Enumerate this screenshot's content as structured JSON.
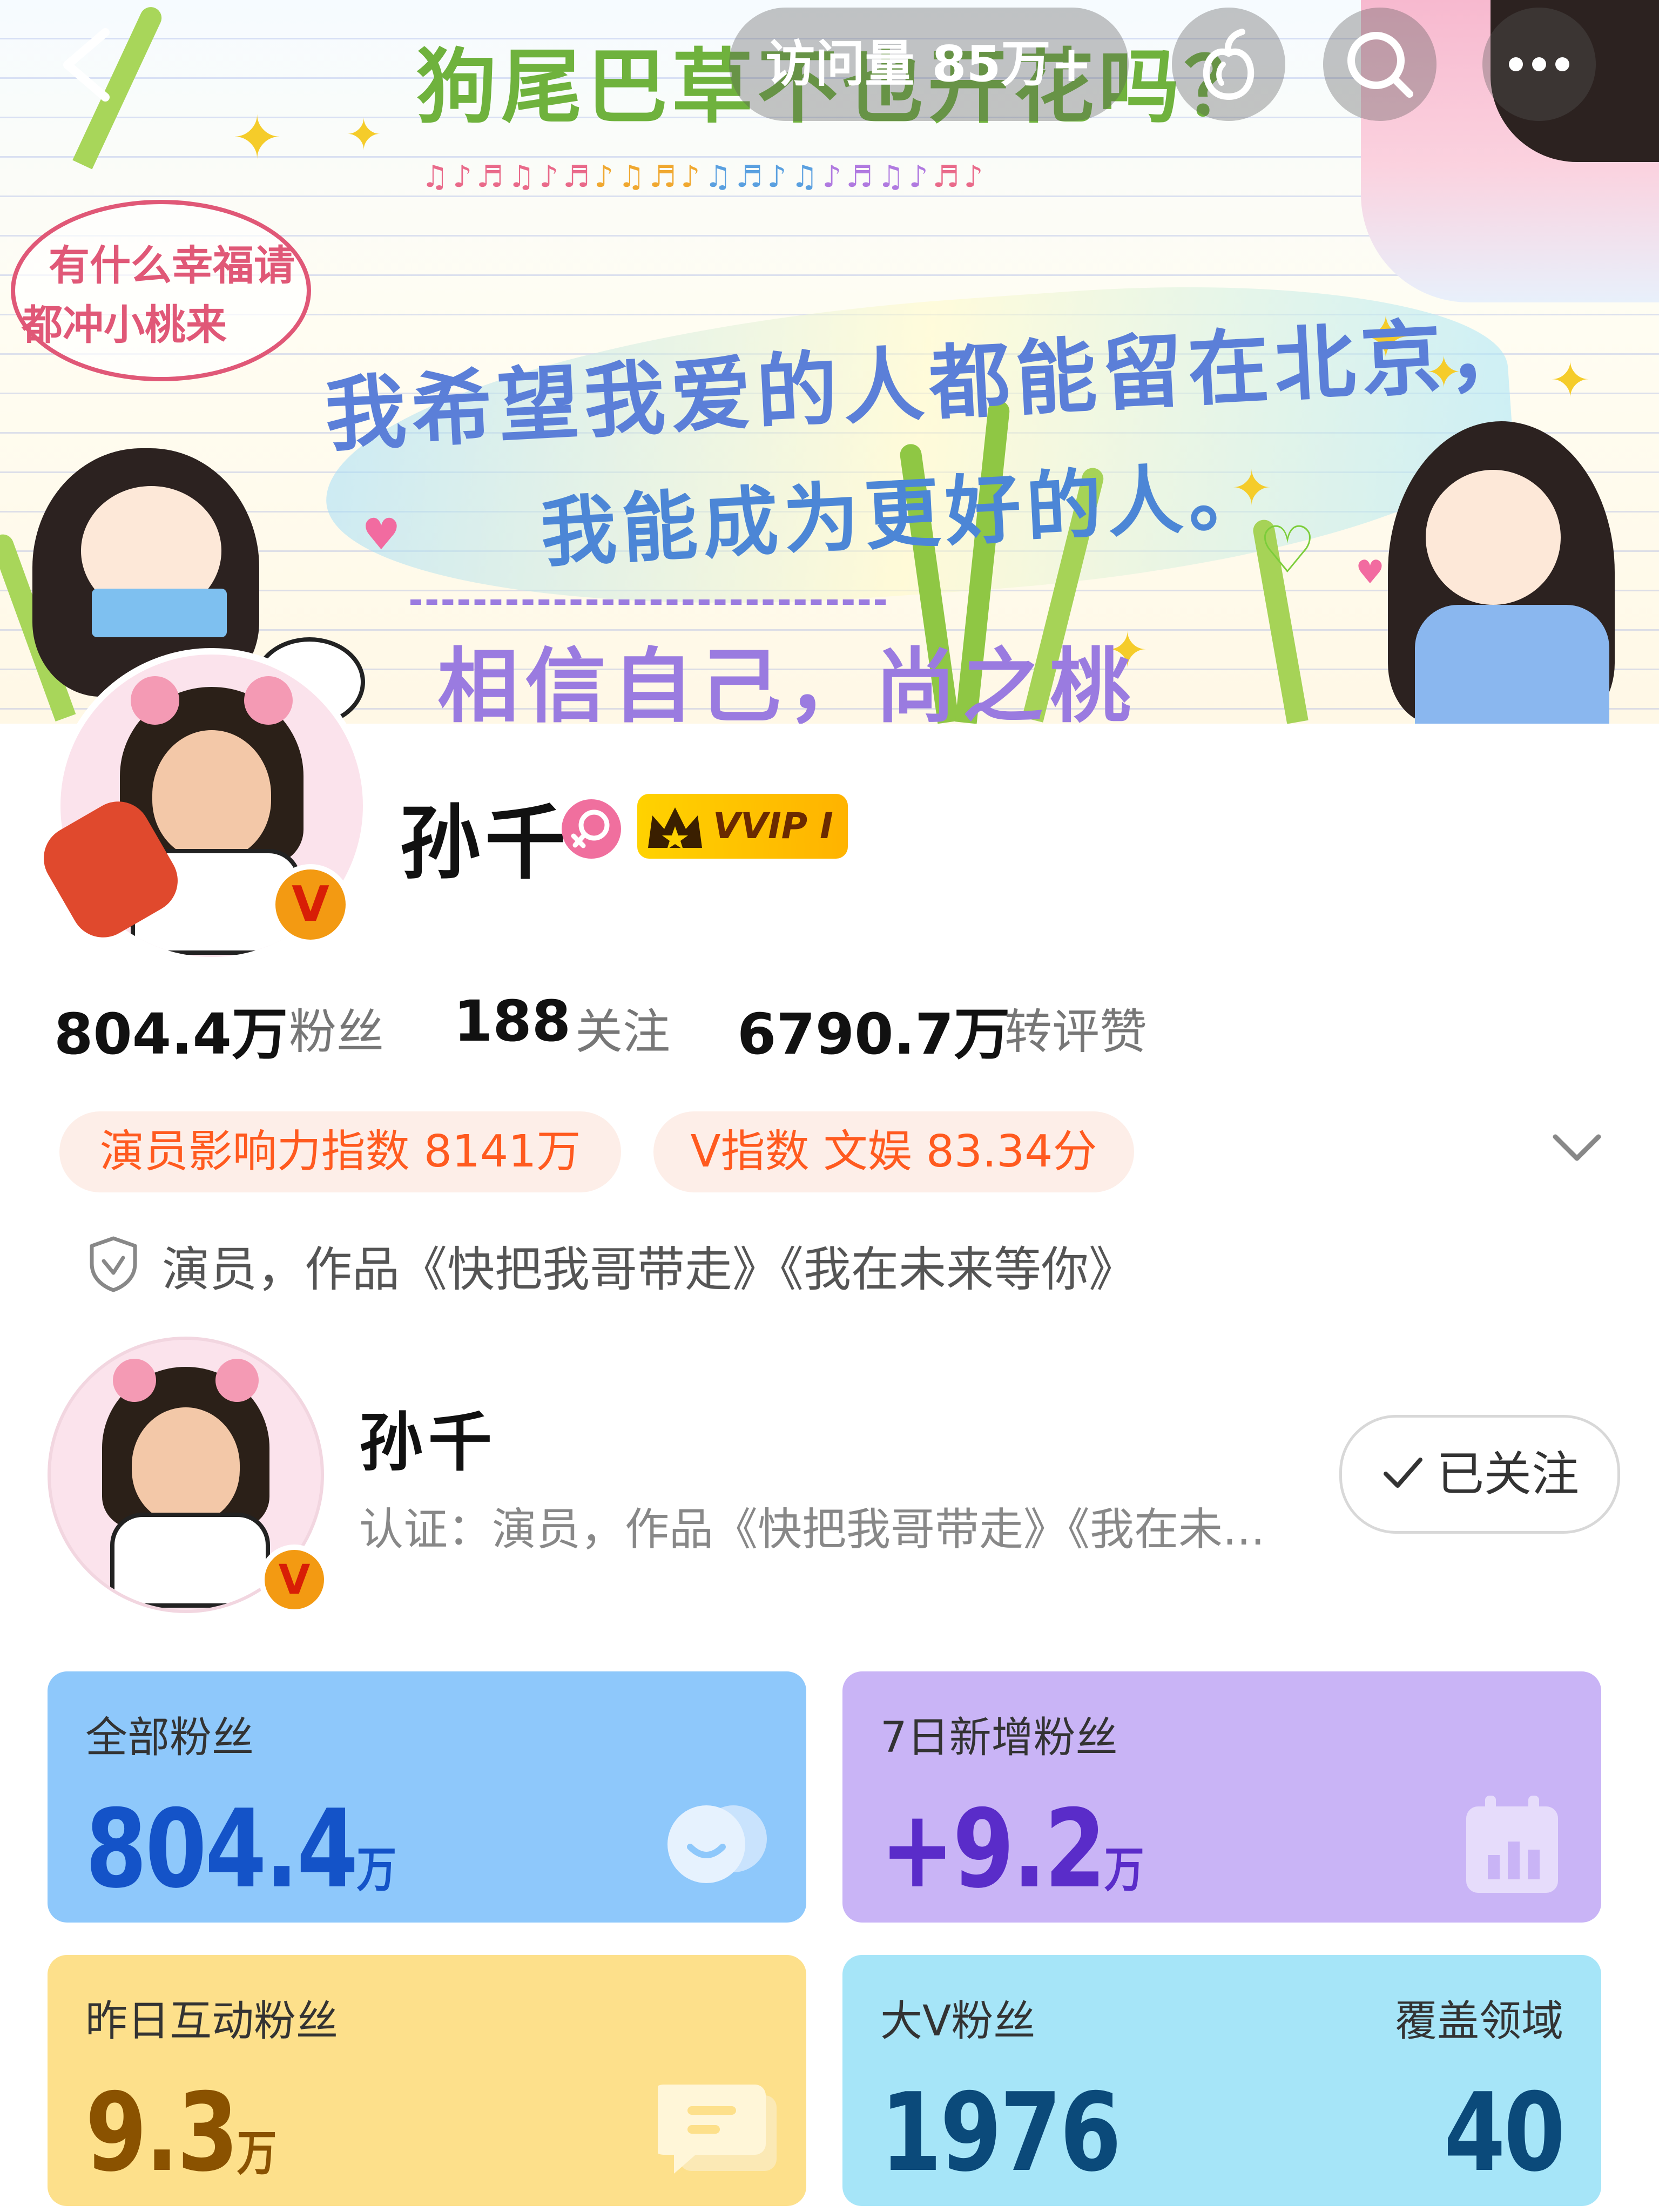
{
  "topbar": {
    "visits_label": "访问量 85万+",
    "back_icon": "chevron-left-icon",
    "peach_icon": "peach-icon",
    "search_icon": "search-icon",
    "more_icon": "more-icon"
  },
  "banner": {
    "title": "狗尾巴草不也开花吗？",
    "bubble_line1": "有什么幸福请",
    "bubble_line2": "都冲小桃来",
    "line1": "我希望我爱的人都能留在北京，",
    "line2": "我能成为更好的人。",
    "line3": "相信自己，尚之桃"
  },
  "profile": {
    "name": "孙千",
    "vip_label": "VVIP I",
    "gender_icon": "female-icon",
    "stats": [
      {
        "value": "804.4万",
        "label": "粉丝"
      },
      {
        "value": "188",
        "label": "关注"
      },
      {
        "value": "6790.7万",
        "label": "转评赞"
      }
    ],
    "chips": [
      "演员影响力指数 8141万",
      "V指数 文娱 83.34分"
    ],
    "verification": "演员，作品《快把我哥带走》《我在未来等你》"
  },
  "follow_card": {
    "name": "孙千",
    "cert": "认证：演员，作品《快把我哥带走》《我在未...",
    "follow_label": "已关注"
  },
  "tiles": {
    "all_fans": {
      "title": "全部粉丝",
      "value": "804.4",
      "unit": "万"
    },
    "new_fans": {
      "title": "7日新增粉丝",
      "value": "+9.2",
      "unit": "万"
    },
    "interact_fans": {
      "title": "昨日互动粉丝",
      "value": "9.3",
      "unit": "万"
    },
    "bigv_fans": {
      "title": "大V粉丝",
      "value": "1976",
      "right_title": "覆盖领域",
      "right_value": "40"
    }
  },
  "colors": {
    "tile_blue": "#8ec8fb",
    "tile_purple": "#c9b4f6",
    "tile_yellow": "#fde08b",
    "tile_cyan": "#a6e5f8",
    "accent_orange": "#ff5a1f"
  }
}
